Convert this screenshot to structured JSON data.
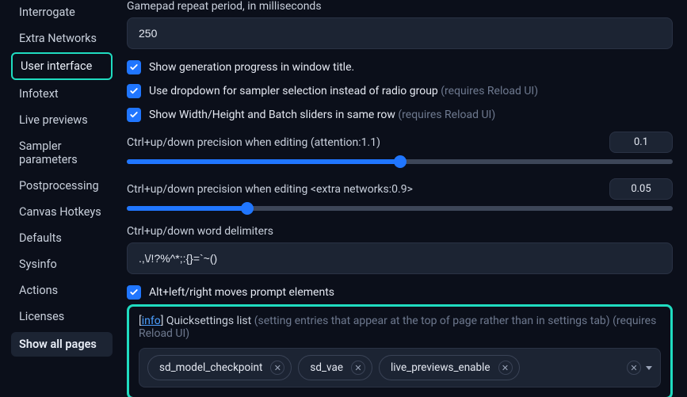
{
  "sidebar": {
    "items": [
      {
        "label": "Interrogate"
      },
      {
        "label": "Extra Networks"
      },
      {
        "label": "User interface",
        "active": true
      },
      {
        "label": "Infotext"
      },
      {
        "label": "Live previews"
      },
      {
        "label": "Sampler parameters"
      },
      {
        "label": "Postprocessing"
      },
      {
        "label": "Canvas Hotkeys"
      },
      {
        "label": "Defaults"
      },
      {
        "label": "Sysinfo"
      },
      {
        "label": "Actions"
      },
      {
        "label": "Licenses"
      }
    ],
    "show_all": "Show all pages"
  },
  "settings": {
    "gamepad": {
      "label": "Gamepad repeat period, in milliseconds",
      "value": "250"
    },
    "cb1": {
      "label": "Show generation progress in window title."
    },
    "cb2": {
      "label": "Use dropdown for sampler selection instead of radio group ",
      "hint": "(requires Reload UI)"
    },
    "cb3": {
      "label": "Show Width/Height and Batch sliders in same row ",
      "hint": "(requires Reload UI)"
    },
    "att": {
      "label": "Ctrl+up/down precision when editing (attention:1.1)",
      "value": "0.1",
      "fill_pct": 50
    },
    "extra": {
      "label": "Ctrl+up/down precision when editing <extra networks:0.9>",
      "value": "0.05",
      "fill_pct": 22
    },
    "delim": {
      "label": "Ctrl+up/down word delimiters",
      "value": ".,\\/!?%^*;:{}=`~()"
    },
    "cb4": {
      "label": "Alt+left/right moves prompt elements"
    },
    "quick": {
      "info": "info",
      "title": " Quicksettings list ",
      "hint1": "(setting entries that appear at the top of page rather than in settings tab)",
      "hint2": " (requires Reload UI)",
      "tags": [
        "sd_model_checkpoint",
        "sd_vae",
        "live_previews_enable"
      ]
    }
  }
}
